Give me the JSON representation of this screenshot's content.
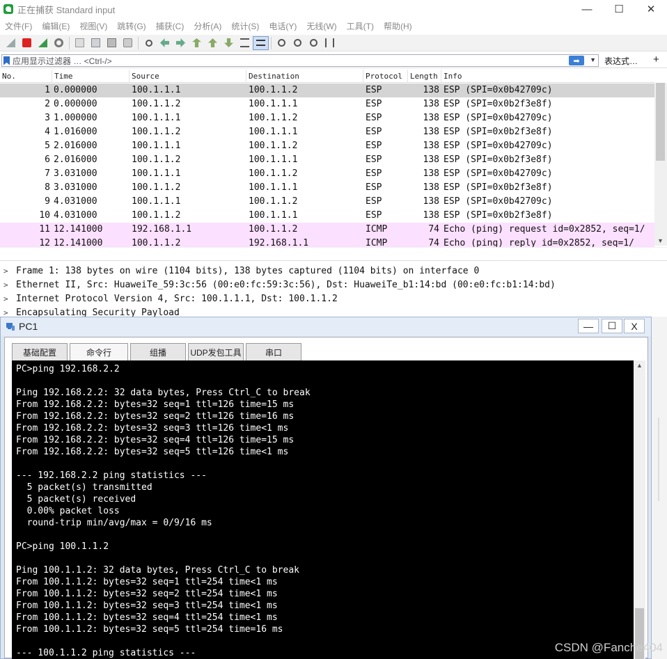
{
  "window": {
    "title": "正在捕获 Standard input",
    "controls": [
      "—",
      "☐",
      "✕"
    ]
  },
  "menu": [
    "文件(F)",
    "编辑(E)",
    "视图(V)",
    "跳转(G)",
    "捕获(C)",
    "分析(A)",
    "统计(S)",
    "电话(Y)",
    "无线(W)",
    "工具(T)",
    "帮助(H)"
  ],
  "toolbar_icons": [
    "shark-fin-start-icon",
    "stop-capture-icon",
    "restart-capture-icon",
    "capture-options-icon",
    "open-file-icon",
    "save-file-icon",
    "close-file-icon",
    "reload-file-icon",
    "find-packet-icon",
    "go-back-icon",
    "go-forward-icon",
    "go-to-packet-icon",
    "first-packet-icon",
    "last-packet-icon",
    "autoscroll-icon",
    "colorize-icon",
    "zoom-in-icon",
    "zoom-out-icon",
    "zoom-reset-icon",
    "resize-columns-icon"
  ],
  "filter": {
    "placeholder": "应用显示过滤器 … <Ctrl-/>",
    "expression_label": "表达式…",
    "plus": "+"
  },
  "packet_list": {
    "columns": [
      "No.",
      "Time",
      "Source",
      "Destination",
      "Protocol",
      "Length",
      "Info"
    ],
    "rows": [
      {
        "no": "1",
        "time": "0.000000",
        "src": "100.1.1.1",
        "dst": "100.1.1.2",
        "proto": "ESP",
        "len": "138",
        "info": "ESP (SPI=0x0b42709c)",
        "kind": "selected"
      },
      {
        "no": "2",
        "time": "0.000000",
        "src": "100.1.1.2",
        "dst": "100.1.1.1",
        "proto": "ESP",
        "len": "138",
        "info": "ESP (SPI=0x0b2f3e8f)",
        "kind": "plain"
      },
      {
        "no": "3",
        "time": "1.000000",
        "src": "100.1.1.1",
        "dst": "100.1.1.2",
        "proto": "ESP",
        "len": "138",
        "info": "ESP (SPI=0x0b42709c)",
        "kind": "plain"
      },
      {
        "no": "4",
        "time": "1.016000",
        "src": "100.1.1.2",
        "dst": "100.1.1.1",
        "proto": "ESP",
        "len": "138",
        "info": "ESP (SPI=0x0b2f3e8f)",
        "kind": "plain"
      },
      {
        "no": "5",
        "time": "2.016000",
        "src": "100.1.1.1",
        "dst": "100.1.1.2",
        "proto": "ESP",
        "len": "138",
        "info": "ESP (SPI=0x0b42709c)",
        "kind": "plain"
      },
      {
        "no": "6",
        "time": "2.016000",
        "src": "100.1.1.2",
        "dst": "100.1.1.1",
        "proto": "ESP",
        "len": "138",
        "info": "ESP (SPI=0x0b2f3e8f)",
        "kind": "plain"
      },
      {
        "no": "7",
        "time": "3.031000",
        "src": "100.1.1.1",
        "dst": "100.1.1.2",
        "proto": "ESP",
        "len": "138",
        "info": "ESP (SPI=0x0b42709c)",
        "kind": "plain"
      },
      {
        "no": "8",
        "time": "3.031000",
        "src": "100.1.1.2",
        "dst": "100.1.1.1",
        "proto": "ESP",
        "len": "138",
        "info": "ESP (SPI=0x0b2f3e8f)",
        "kind": "plain"
      },
      {
        "no": "9",
        "time": "4.031000",
        "src": "100.1.1.1",
        "dst": "100.1.1.2",
        "proto": "ESP",
        "len": "138",
        "info": "ESP (SPI=0x0b42709c)",
        "kind": "plain"
      },
      {
        "no": "10",
        "time": "4.031000",
        "src": "100.1.1.2",
        "dst": "100.1.1.1",
        "proto": "ESP",
        "len": "138",
        "info": "ESP (SPI=0x0b2f3e8f)",
        "kind": "plain"
      },
      {
        "no": "11",
        "time": "12.141000",
        "src": "192.168.1.1",
        "dst": "100.1.1.2",
        "proto": "ICMP",
        "len": "74",
        "info": "Echo (ping) request  id=0x2852, seq=1/",
        "kind": "icmp"
      },
      {
        "no": "12",
        "time": "12.141000",
        "src": "100.1.1.2",
        "dst": "192.168.1.1",
        "proto": "ICMP",
        "len": "74",
        "info": "Echo (ping) reply    id=0x2852, seq=1/",
        "kind": "icmp"
      }
    ],
    "colors": {
      "selected": "#d4d4d4",
      "plain": "#ffffff",
      "icmp": "#fce0ff"
    }
  },
  "packet_details": [
    "Frame 1: 138 bytes on wire (1104 bits), 138 bytes captured (1104 bits) on interface 0",
    "Ethernet II, Src: HuaweiTe_59:3c:56 (00:e0:fc:59:3c:56), Dst: HuaweiTe_b1:14:bd (00:e0:fc:b1:14:bd)",
    "Internet Protocol Version 4, Src: 100.1.1.1, Dst: 100.1.1.2",
    "Encapsulating Security Payload"
  ],
  "pc1": {
    "title": "PC1",
    "controls": [
      "—",
      "☐",
      "X"
    ],
    "tabs": [
      "基础配置",
      "命令行",
      "组播",
      "UDP发包工具",
      "串口"
    ],
    "active_tab": "命令行",
    "terminal_lines": [
      "PC>ping 192.168.2.2",
      "",
      "Ping 192.168.2.2: 32 data bytes, Press Ctrl_C to break",
      "From 192.168.2.2: bytes=32 seq=1 ttl=126 time=15 ms",
      "From 192.168.2.2: bytes=32 seq=2 ttl=126 time=16 ms",
      "From 192.168.2.2: bytes=32 seq=3 ttl=126 time<1 ms",
      "From 192.168.2.2: bytes=32 seq=4 ttl=126 time=15 ms",
      "From 192.168.2.2: bytes=32 seq=5 ttl=126 time<1 ms",
      "",
      "--- 192.168.2.2 ping statistics ---",
      "  5 packet(s) transmitted",
      "  5 packet(s) received",
      "  0.00% packet loss",
      "  round-trip min/avg/max = 0/9/16 ms",
      "",
      "PC>ping 100.1.1.2",
      "",
      "Ping 100.1.1.2: 32 data bytes, Press Ctrl_C to break",
      "From 100.1.1.2: bytes=32 seq=1 ttl=254 time<1 ms",
      "From 100.1.1.2: bytes=32 seq=2 ttl=254 time<1 ms",
      "From 100.1.1.2: bytes=32 seq=3 ttl=254 time<1 ms",
      "From 100.1.1.2: bytes=32 seq=4 ttl=254 time<1 ms",
      "From 100.1.1.2: bytes=32 seq=5 ttl=254 time=16 ms",
      "",
      "--- 100.1.1.2 ping statistics ---"
    ]
  },
  "watermark": "CSDN @Fanche404"
}
